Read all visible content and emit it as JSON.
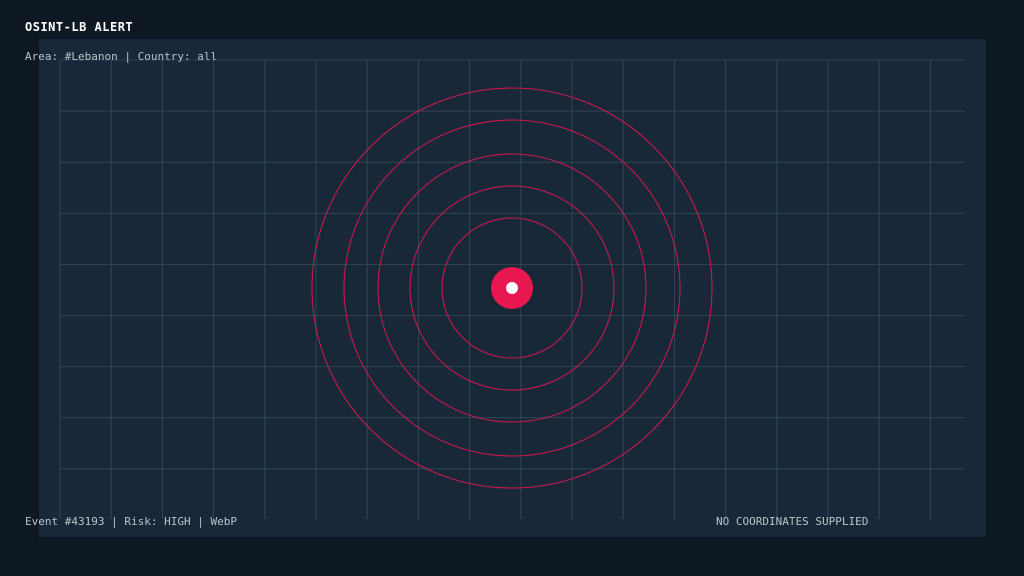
{
  "header": {
    "title": "OSINT-LB ALERT",
    "area_label": "Area: #Lebanon",
    "separator": "|",
    "country_label": "Country: all"
  },
  "footer": {
    "event": "Event #43193",
    "separator": "|",
    "risk": "Risk: HIGH",
    "format": "WebP",
    "status": "NO COORDINATES SUPPLIED"
  },
  "colors": {
    "background": "#0d1823",
    "panel": "#182839",
    "grid": "#3a5566",
    "alert": "#e8174f",
    "marker_center": "#ffffff"
  },
  "icons": {
    "marker": "alert-pulse-icon"
  }
}
